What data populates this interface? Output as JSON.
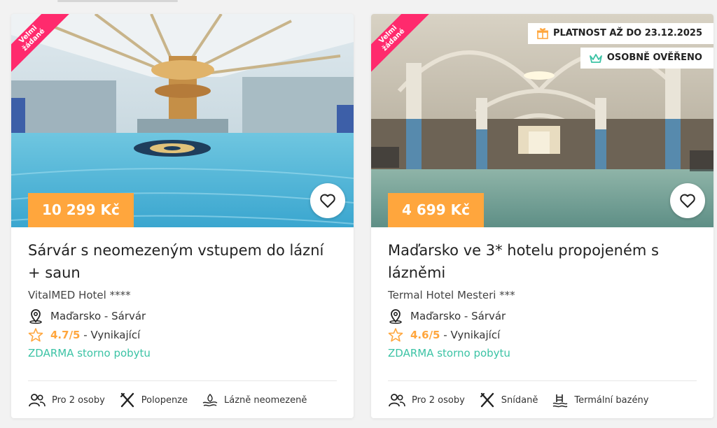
{
  "cards": [
    {
      "ribbon": [
        "Velmi",
        "žádané"
      ],
      "price": "10 299 Kč",
      "title": "Sárvár s neomezeným vstupem do lázní + saun",
      "hotel": "VitalMED Hotel ****",
      "location": "Maďarsko - Sárvár",
      "rating_value": "4.7/5",
      "rating_text": "- Vynikající",
      "storno": "ZDARMA storno pobytu",
      "features": [
        "Pro 2 osoby",
        "Polopenze",
        "Lázně neomezeně"
      ],
      "badges": []
    },
    {
      "ribbon": [
        "Velmi",
        "žádané"
      ],
      "price": "4 699 Kč",
      "title": "Maďarsko ve 3* hotelu propojeném s lázněmi",
      "hotel": "Termal Hotel Mesteri ***",
      "location": "Maďarsko - Sárvár",
      "rating_value": "4.6/5",
      "rating_text": "- Vynikající",
      "storno": "ZDARMA storno pobytu",
      "features": [
        "Pro 2 osoby",
        "Snídaně",
        "Termální bazény"
      ],
      "badges": [
        "PLATNOST AŽ DO 23.12.2025",
        "OSOBNĚ OVĚŘENO"
      ]
    }
  ],
  "colors": {
    "accent": "#ffa63d",
    "ribbon": "#ff2a6d",
    "storno": "#3cc3a5",
    "badge_icon": "#3cc3a5"
  },
  "icons": [
    "location-pin-icon",
    "star-outline-icon",
    "heart-outline-icon",
    "people-icon",
    "cutlery-icon",
    "spa-icon",
    "pool-ladder-icon",
    "gift-icon",
    "crown-icon"
  ]
}
